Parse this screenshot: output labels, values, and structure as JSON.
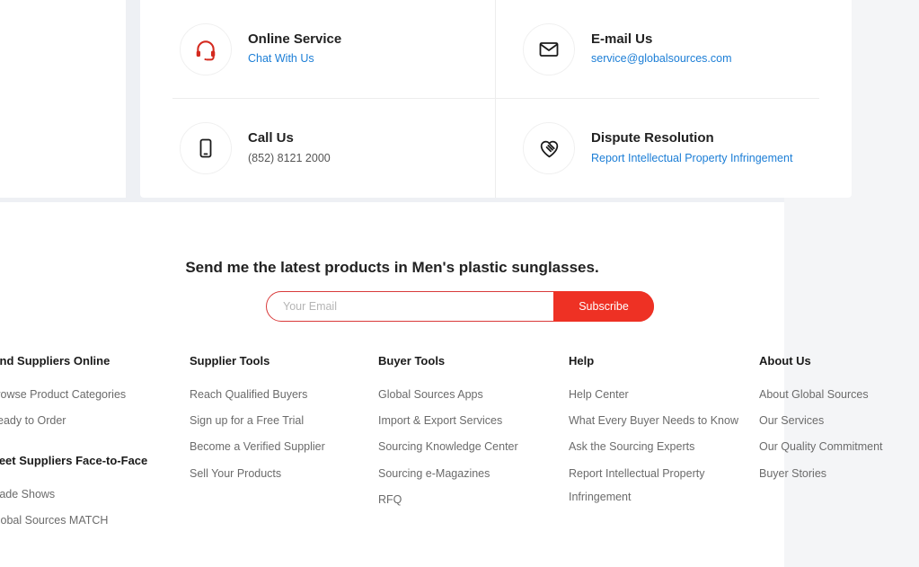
{
  "contact": {
    "items": [
      {
        "icon": "headset-icon",
        "title": "Online Service",
        "link": "Chat With Us",
        "link_type": "link"
      },
      {
        "icon": "envelope-icon",
        "title": "E-mail Us",
        "link": "service@globalsources.com",
        "link_type": "link"
      },
      {
        "icon": "mobile-phone-icon",
        "title": "Call Us",
        "link": "(852) 8121 2000",
        "link_type": "plain"
      },
      {
        "icon": "heart-handshake-icon",
        "title": "Dispute Resolution",
        "link": "Report Intellectual Property Infringement",
        "link_type": "link"
      }
    ]
  },
  "newsletter": {
    "heading": "Send me the latest products in Men's plastic sunglasses.",
    "email_placeholder": "Your Email",
    "email_value": "",
    "subscribe_label": "Subscribe",
    "accent_color": "#ee3124",
    "border_color": "#d93a3a"
  },
  "footer": {
    "columns": [
      {
        "title": "Find Suppliers Online",
        "links": [
          "Browse Product Categories",
          "Ready to Order"
        ],
        "subtitle": "Meet Suppliers Face-to-Face",
        "sublinks": [
          "Trade Shows",
          "Global Sources MATCH"
        ]
      },
      {
        "title": "Supplier Tools",
        "links": [
          "Reach Qualified Buyers",
          "Sign up for a Free Trial",
          "Become a Verified Supplier",
          "Sell Your Products"
        ]
      },
      {
        "title": "Buyer Tools",
        "links": [
          "Global Sources Apps",
          "Import & Export Services",
          "Sourcing Knowledge Center",
          "Sourcing e-Magazines",
          "RFQ"
        ]
      },
      {
        "title": "Help",
        "links": [
          "Help Center",
          "What Every Buyer Needs to Know",
          "Ask the Sourcing Experts",
          "Report Intellectual Property",
          "Infringement"
        ]
      },
      {
        "title": "About Us",
        "links": [
          "About Global Sources",
          "Our Services",
          "Our Quality Commitment",
          "Buyer Stories"
        ]
      }
    ]
  }
}
